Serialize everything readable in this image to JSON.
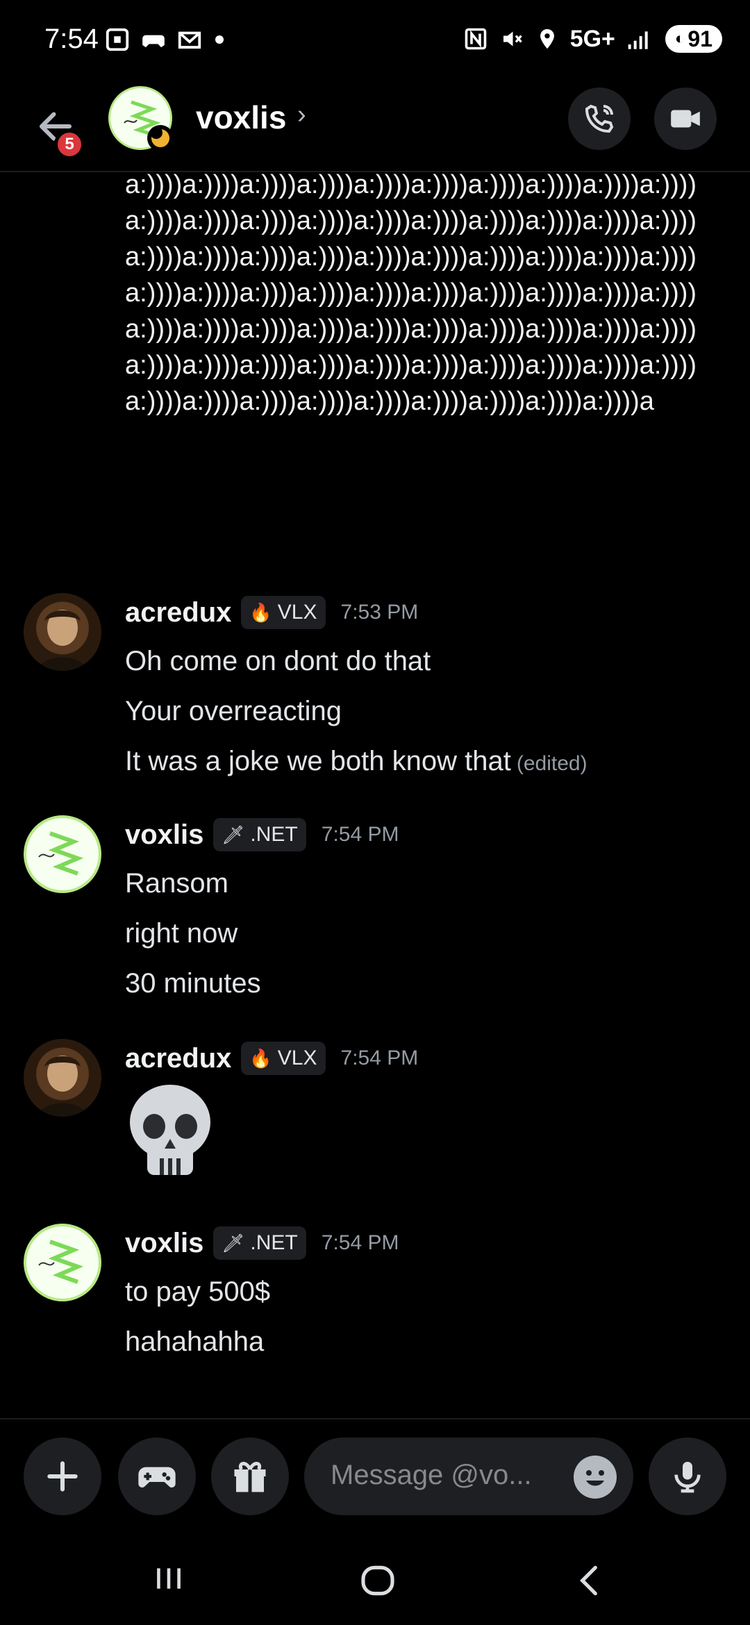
{
  "status_bar": {
    "time": "7:54",
    "network": "5G+",
    "battery": "91",
    "icons": [
      "screenshot-icon",
      "game-icon",
      "mail-icon",
      "dot-icon",
      "nfc-icon",
      "mute-icon",
      "location-icon",
      "signal-icon"
    ]
  },
  "header": {
    "unread_count": "5",
    "title": "voxlis",
    "chevron": "›",
    "presence_color": "#f0b232"
  },
  "spam_text": "a:))))a:))))a:))))a:))))a:))))a:))))a:))))a:))))a:))))a:))))a:))))a:))))a:))))a:))))a:))))a:))))a:))))a:))))a:))))a:))))a:))))a:))))a:))))a:))))a:))))a:))))a:))))a:))))a:))))a:))))a:))))a:))))a:))))a:))))a:))))a:))))a:))))a:))))a:))))a:))))a:))))a:))))a:))))a:))))a:))))a:))))a:))))a:))))a:))))a:))))a:))))a:))))a:))))a:))))a:))))a:))))a:))))a:))))a:))))a:))))a:))))a:))))a:))))a:))))a:))))a:))))a:))))a:))))a:))))a",
  "messages": [
    {
      "author": "acredux",
      "tag": "VLX",
      "time": "7:53 PM",
      "lines": [
        "Oh come on dont do that",
        "Your overreacting",
        "It was a joke we both know that"
      ],
      "edited": "(edited)"
    },
    {
      "author": "voxlis",
      "tag": ".NET",
      "time": "7:54 PM",
      "lines": [
        "Ransom",
        "right now",
        "30 minutes"
      ]
    },
    {
      "author": "acredux",
      "tag": "VLX",
      "time": "7:54 PM",
      "emoji": "skull"
    },
    {
      "author": "voxlis",
      "tag": ".NET",
      "time": "7:54 PM",
      "lines": [
        "to pay 500$",
        "hahahahha"
      ]
    }
  ],
  "composer": {
    "placeholder": "Message @vo..."
  },
  "colors": {
    "background": "#000000",
    "badge": "#da373c",
    "surface": "#1e1f22",
    "muted_text": "#949ba4"
  }
}
